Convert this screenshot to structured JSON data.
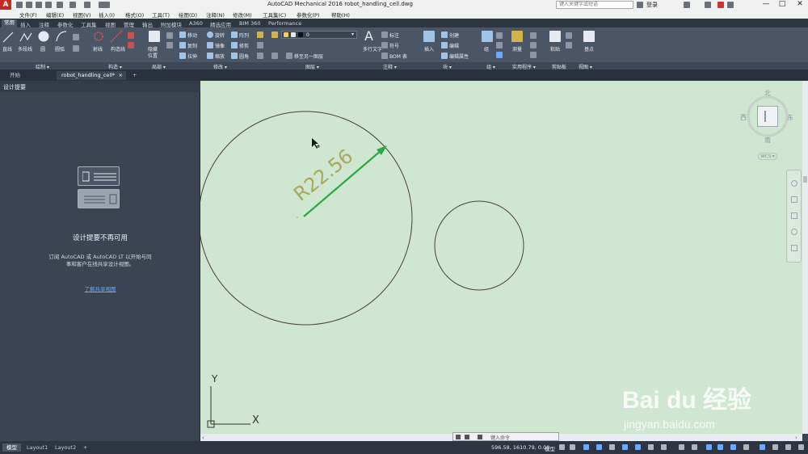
{
  "titlebar": {
    "app_title": "AutoCAD Mechanical 2016      robot_handling_cell.dwg",
    "search_placeholder": "键入关键字或短语",
    "login": "登录",
    "minimize": "—",
    "maximize": "□",
    "close": "✕"
  },
  "menubar": {
    "items": [
      "文件(F)",
      "编辑(E)",
      "视图(V)",
      "插入(I)",
      "格式(O)",
      "工具(T)",
      "绘图(D)",
      "注释(N)",
      "修改(M)",
      "工具集(C)",
      "参数化(P)",
      "帮助(H)"
    ]
  },
  "ribbon_tabs": {
    "items": [
      "常用",
      "插入",
      "注释",
      "参数化",
      "工具集",
      "视图",
      "管理",
      "输出",
      "附加模块",
      "A360",
      "精选应用",
      "BIM 360",
      "Performance"
    ]
  },
  "ribbon": {
    "draw_tools": [
      "直线",
      "多段线",
      "圆",
      "圆弧"
    ],
    "construct_tools": [
      "射线",
      "构造线"
    ],
    "detail_tools": [
      "隐藏",
      "位置"
    ],
    "modify_tools": [
      "移动",
      "旋转",
      "阵列",
      "复制",
      "镜像",
      "修剪",
      "拉伸",
      "缩放",
      "圆角"
    ],
    "layer_tools": [
      "0",
      "移至另一图层"
    ],
    "annotation_tools": [
      "多行文字",
      "标注",
      "符号",
      "BOM 表"
    ],
    "block_tools": [
      "插入",
      "创建",
      "编辑",
      "编辑属性"
    ],
    "group_tools": [
      "组"
    ],
    "utility_tools": [
      "测量"
    ],
    "clipboard_tools": [
      "粘贴"
    ],
    "view_tools": [
      "基点"
    ]
  },
  "panel_labels": [
    "绘制 ▾",
    "构造 ▾",
    "局部 ▾",
    "修改 ▾",
    "图层 ▾",
    "注释 ▾",
    "块 ▾",
    "组 ▾",
    "实用程序 ▾",
    "剪贴板",
    "视图 ▾"
  ],
  "doc_tabs": {
    "start": "开始",
    "drawing": "robot_handling_cell*",
    "close": "×",
    "add": "+"
  },
  "left_panel": {
    "title": "设计提要",
    "msg_title": "设计提要不再可用",
    "msg_body_line1": "订阅 AutoCAD 或 AutoCAD LT 以开始与同",
    "msg_body_line2": "事和客户在线共享设计视图。",
    "link": "了解共享视图"
  },
  "canvas": {
    "dimension_text": "R22.56",
    "axis_y": "Y",
    "axis_x": "X"
  },
  "viewcube": {
    "north": "北",
    "south": "南",
    "east": "东",
    "west": "西",
    "wcs": "WCS ▾"
  },
  "command_line": {
    "placeholder": "键入命令"
  },
  "statusbar": {
    "tabs": [
      "模型",
      "Layout1",
      "Layout2"
    ],
    "add": "+",
    "coords": "596.58, 1610.79, 0.00",
    "model": "模型"
  },
  "watermark": {
    "logo": "Bai du 经验",
    "url": "jingyan.baidu.com"
  },
  "colors": {
    "canvas_bg": "#cfe6d1",
    "dimension_arrow": "#28a745",
    "dimension_text": "#a6a85c",
    "circle_stroke": "#4a4040",
    "app_red": "#c8281e"
  }
}
